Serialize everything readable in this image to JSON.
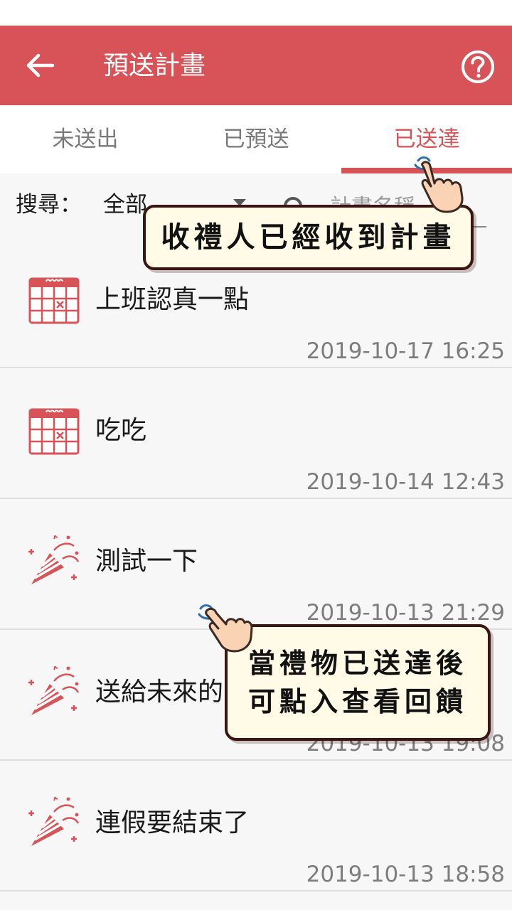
{
  "app_bar": {
    "title": "預送計畫",
    "back_icon": "arrow-left-icon",
    "help_icon": "help-circle-icon",
    "color": "#d75358"
  },
  "tabs": [
    {
      "label": "未送出",
      "active": false
    },
    {
      "label": "已預送",
      "active": false
    },
    {
      "label": "已送達",
      "active": true
    }
  ],
  "filter": {
    "label": "搜尋：",
    "selected": "全部",
    "search_placeholder": "計畫名稱"
  },
  "items": [
    {
      "title": "上班認真一點",
      "time": "2019-10-17 16:25",
      "icon": "calendar-icon"
    },
    {
      "title": "吃吃",
      "time": "2019-10-14 12:43",
      "icon": "calendar-icon"
    },
    {
      "title": "測試一下",
      "time": "2019-10-13 21:29",
      "icon": "party-popper-icon"
    },
    {
      "title": "送給未來的",
      "time": "2019-10-13 19:08",
      "icon": "party-popper-icon"
    },
    {
      "title": "連假要結束了",
      "time": "2019-10-13 18:58",
      "icon": "party-popper-icon"
    }
  ],
  "callouts": {
    "delivered": "收禮人已經收到計畫",
    "feedback_line1": "當禮物已送達後",
    "feedback_line2": "可點入查看回饋"
  },
  "colors": {
    "accent": "#d75358",
    "callout_bg": "#fffbe6",
    "callout_border": "#3a1511"
  }
}
